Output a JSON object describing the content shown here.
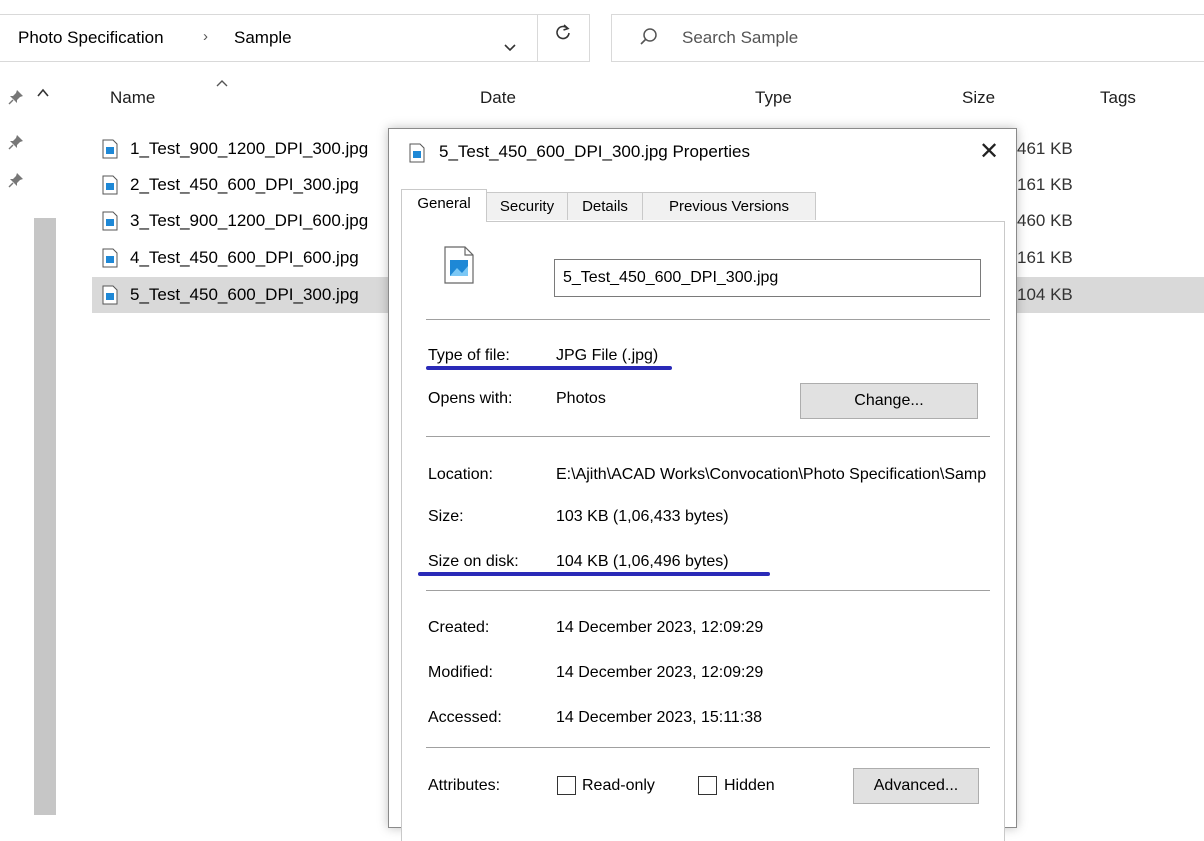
{
  "address": {
    "crumbs": [
      "Photo Specification",
      "Sample"
    ],
    "separator": "›",
    "search_placeholder": "Search Sample"
  },
  "columns": {
    "name": "Name",
    "date": "Date",
    "type": "Type",
    "size": "Size",
    "tags": "Tags"
  },
  "files": [
    {
      "name": "1_Test_900_1200_DPI_300.jpg",
      "size": "461 KB"
    },
    {
      "name": "2_Test_450_600_DPI_300.jpg",
      "size": "161 KB"
    },
    {
      "name": "3_Test_900_1200_DPI_600.jpg",
      "size": "460 KB"
    },
    {
      "name": "4_Test_450_600_DPI_600.jpg",
      "size": "161 KB"
    },
    {
      "name": "5_Test_450_600_DPI_300.jpg",
      "size": "104 KB",
      "selected": true
    }
  ],
  "dialog": {
    "title": "5_Test_450_600_DPI_300.jpg Properties",
    "close": "✕",
    "tabs": [
      "General",
      "Security",
      "Details",
      "Previous Versions"
    ],
    "active_tab": "General",
    "filename": "5_Test_450_600_DPI_300.jpg",
    "type_label": "Type of file:",
    "type_value": "JPG File (.jpg)",
    "opens_label": "Opens with:",
    "opens_value": "Photos",
    "change_button": "Change...",
    "location_label": "Location:",
    "location_value": "E:\\Ajith\\ACAD Works\\Convocation\\Photo Specification\\Sample",
    "size_label": "Size:",
    "size_value": "103 KB (1,06,433 bytes)",
    "disk_label": "Size on disk:",
    "disk_value": "104 KB (1,06,496 bytes)",
    "created_label": "Created:",
    "created_value": "14 December 2023, 12:09:29",
    "modified_label": "Modified:",
    "modified_value": "14 December 2023, 12:09:29",
    "accessed_label": "Accessed:",
    "accessed_value": "14 December 2023, 15:11:38",
    "attributes_label": "Attributes:",
    "readonly_label": "Read-only",
    "hidden_label": "Hidden",
    "advanced_button": "Advanced..."
  },
  "colors": {
    "annotation": "#2a2ab8",
    "selection": "#d9d9d9",
    "jpg_icon": "#1e88d6"
  }
}
